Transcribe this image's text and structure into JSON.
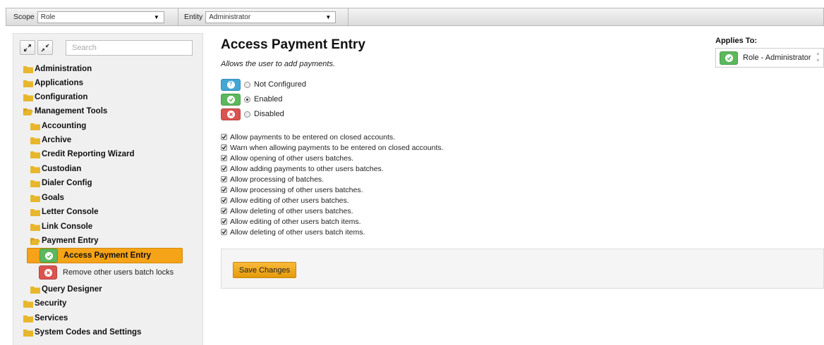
{
  "toolbar": {
    "scope_label": "Scope",
    "scope_value": "Role",
    "entity_label": "Entity",
    "entity_value": "Administrator"
  },
  "sidebar": {
    "search_placeholder": "Search",
    "tree": {
      "administration": "Administration",
      "applications": "Applications",
      "configuration": "Configuration",
      "management_tools": "Management Tools",
      "accounting": "Accounting",
      "archive": "Archive",
      "credit_reporting_wizard": "Credit Reporting Wizard",
      "custodian": "Custodian",
      "dialer_config": "Dialer Config",
      "goals": "Goals",
      "letter_console": "Letter Console",
      "link_console": "Link Console",
      "payment_entry": "Payment Entry",
      "access_payment_entry": "Access Payment Entry",
      "remove_batch_locks": "Remove other users batch locks",
      "query_designer": "Query Designer",
      "security": "Security",
      "services": "Services",
      "system_codes": "System Codes and Settings"
    }
  },
  "main": {
    "title": "Access Payment Entry",
    "subtitle": "Allows the user to add payments.",
    "options": {
      "not_configured": "Not Configured",
      "enabled": "Enabled",
      "disabled": "Disabled"
    },
    "selected_option": "Enabled",
    "checks": [
      "Allow payments to be entered on closed accounts.",
      "Warn when allowing payments to be entered on closed accounts.",
      "Allow opening of other users batches.",
      "Allow adding payments to other users batches.",
      "Allow processing of batches.",
      "Allow processing of other users batches.",
      "Allow editing of other users batches.",
      "Allow deleting of other users batches.",
      "Allow editing of other users batch items.",
      "Allow deleting of other users batch items."
    ],
    "save_label": "Save Changes"
  },
  "applies_to": {
    "label": "Applies To:",
    "value": "Role - Administrator"
  },
  "colors": {
    "folder": "#e8b62c",
    "accent_orange": "#f5a317",
    "success_green": "#5cb85c",
    "danger_red": "#d9534f",
    "info_blue": "#44a6d4"
  }
}
